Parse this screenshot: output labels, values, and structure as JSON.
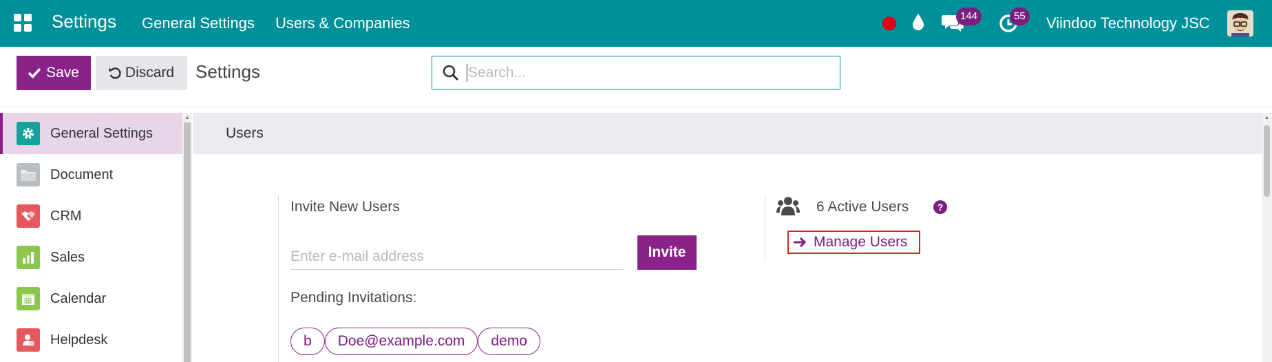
{
  "navbar": {
    "app_title": "Settings",
    "links": [
      "General Settings",
      "Users & Companies"
    ],
    "chat_badge": "144",
    "activity_badge": "55",
    "company": "Viindoo Technology JSC",
    "icons": [
      "apps-grid-icon",
      "recording-dot-icon",
      "drop-icon",
      "chat-icon",
      "activity-clock-icon",
      "avatar"
    ],
    "accent_color": "#00909a"
  },
  "control": {
    "save_label": "Save",
    "discard_label": "Discard",
    "title": "Settings",
    "search_placeholder": "Search..."
  },
  "sidebar": {
    "items": [
      {
        "label": "General Settings",
        "icon": "gear-icon",
        "active": true
      },
      {
        "label": "Document",
        "icon": "folder-icon"
      },
      {
        "label": "CRM",
        "icon": "handshake-icon"
      },
      {
        "label": "Sales",
        "icon": "chart-icon"
      },
      {
        "label": "Calendar",
        "icon": "calendar-icon"
      },
      {
        "label": "Helpdesk",
        "icon": "helpdesk-icon"
      }
    ]
  },
  "main": {
    "section_title": "Users",
    "invite_title": "Invite New Users",
    "email_placeholder": "Enter e-mail address",
    "invite_label": "Invite",
    "pending_title": "Pending Invitations:",
    "pending": [
      "b",
      "Doe@example.com",
      "demo"
    ],
    "active_users": "6 Active Users",
    "help": "?",
    "manage_users": "Manage Users",
    "brand_color": "#8a2389"
  }
}
